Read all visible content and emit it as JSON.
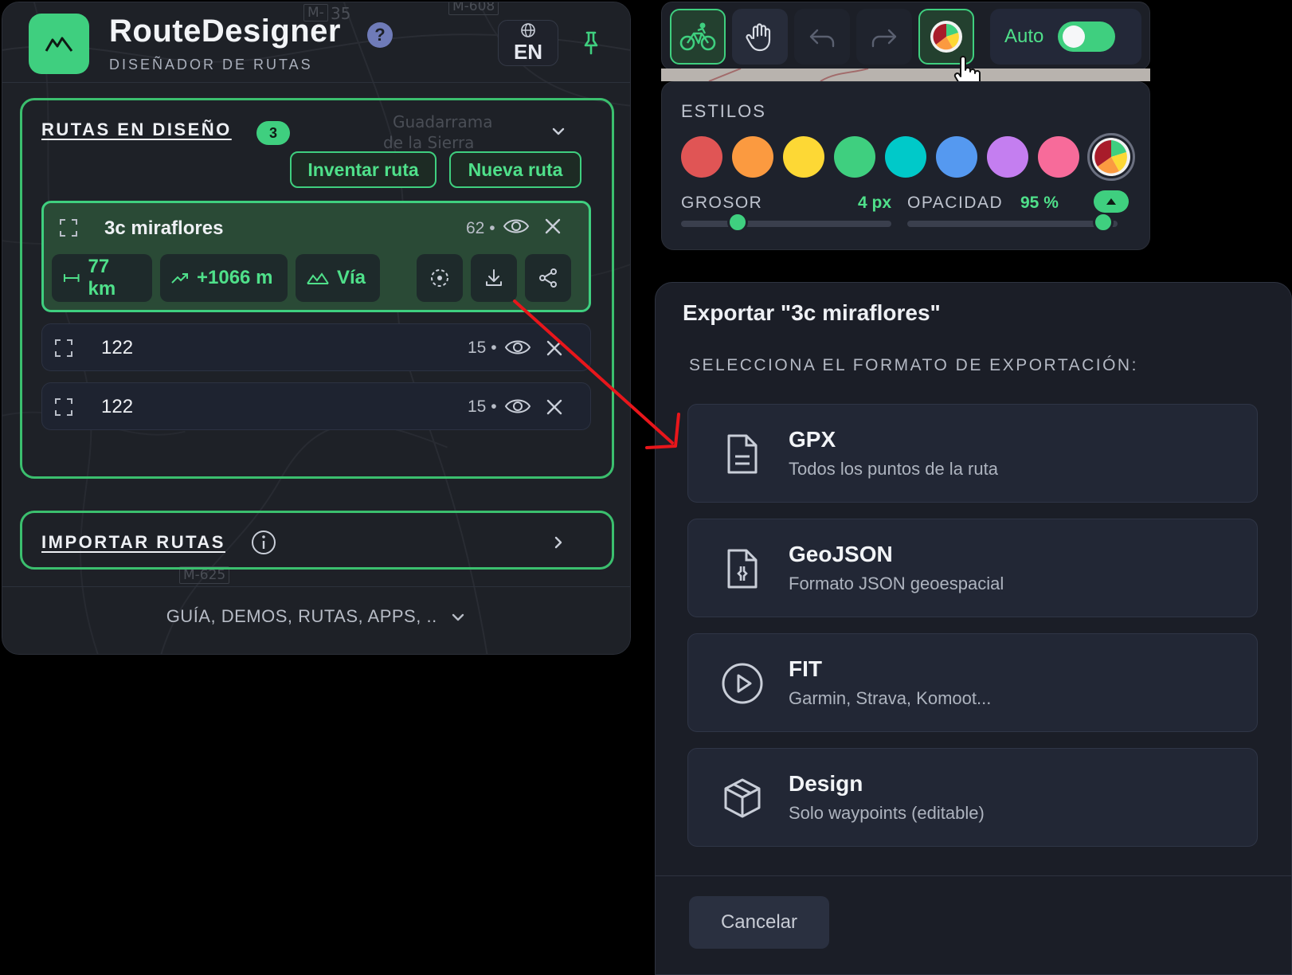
{
  "brand": {
    "title": "RouteDesigner",
    "subtitle": "DISEÑADOR DE RUTAS",
    "help": "?",
    "language": "EN"
  },
  "map_labels": [
    "M-",
    "35",
    "M-608",
    "Guadarrama",
    "de la Sierra",
    "M-625"
  ],
  "routes_section": {
    "title": "RUTAS EN DISEÑO",
    "count": "3",
    "invent_label": "Inventar ruta",
    "new_label": "Nueva ruta",
    "routes": [
      {
        "name": "3c miraflores",
        "count": "62 •",
        "active": true
      },
      {
        "name": "122",
        "count": "15 •",
        "active": false
      },
      {
        "name": "122",
        "count": "15 •",
        "active": false
      }
    ],
    "active_stats": {
      "distance": "77 km",
      "elevation": "+1066 m",
      "type": "Vía"
    }
  },
  "import_section": {
    "title": "IMPORTAR RUTAS"
  },
  "footer": {
    "link": "GUÍA, DEMOS, RUTAS, APPS, .."
  },
  "toolbar": {
    "auto_label": "Auto",
    "auto_on": true,
    "buttons": [
      "bike-icon",
      "hand-icon",
      "undo-icon",
      "redo-icon",
      "palette-icon"
    ]
  },
  "styles": {
    "title": "ESTILOS",
    "colors": [
      "#e05555",
      "#fb9a40",
      "#fdd835",
      "#3fcf7f",
      "#00c9c9",
      "#5599f0",
      "#c47ef0",
      "#f76b9a"
    ],
    "thickness_label": "GROSOR",
    "thickness_value": "4 px",
    "opacity_label": "OPACIDAD",
    "opacity_value": "95 %",
    "thickness_fraction": 0.27,
    "opacity_fraction": 0.93
  },
  "export_dialog": {
    "title": "Exportar \"3c miraflores\"",
    "subtitle": "SELECCIONA EL FORMATO DE EXPORTACIÓN:",
    "options": [
      {
        "name": "GPX",
        "desc": "Todos los puntos de la ruta",
        "icon": "file-text-icon"
      },
      {
        "name": "GeoJSON",
        "desc": "Formato JSON geoespacial",
        "icon": "file-json-icon"
      },
      {
        "name": "FIT",
        "desc": "Garmin, Strava, Komoot...",
        "icon": "play-circle-icon"
      },
      {
        "name": "Design",
        "desc": "Solo waypoints (editable)",
        "icon": "box-icon"
      }
    ],
    "cancel_label": "Cancelar"
  },
  "colors": {
    "accent": "#3fcf7f",
    "arrow": "#e8161b",
    "panel": "#1c1f26"
  }
}
